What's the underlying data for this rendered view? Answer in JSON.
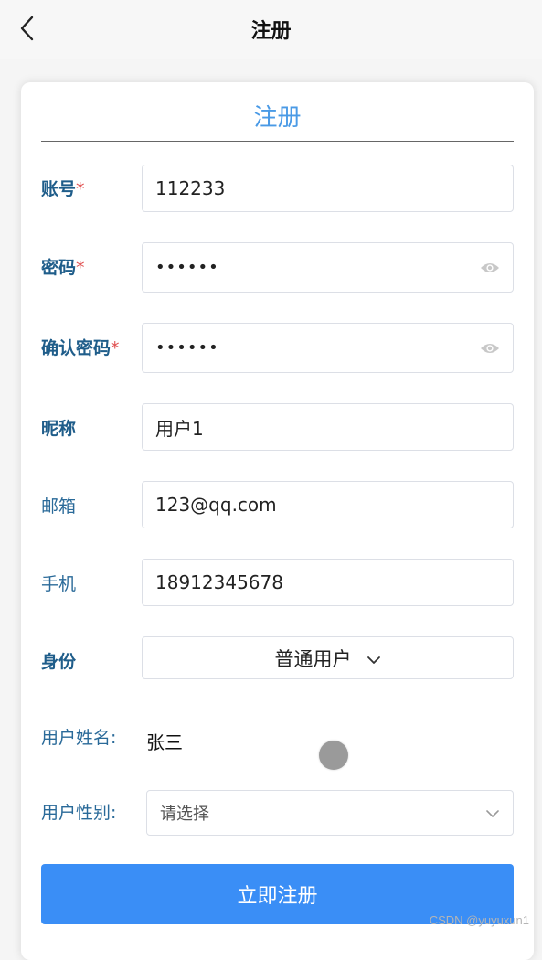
{
  "header": {
    "title": "注册",
    "back_icon": "chevron-left-icon"
  },
  "card": {
    "title": "注册"
  },
  "form": {
    "account": {
      "label": "账号",
      "required": "*",
      "value": "112233"
    },
    "password": {
      "label": "密码",
      "required": "*",
      "value": "••••••",
      "toggle_icon": "eye-icon"
    },
    "confirm_password": {
      "label": "确认密码",
      "required": "*",
      "value": "••••••",
      "toggle_icon": "eye-icon"
    },
    "nickname": {
      "label": "昵称",
      "value": "用户1"
    },
    "email": {
      "label": "邮箱",
      "value": "123@qq.com"
    },
    "phone": {
      "label": "手机",
      "value": "18912345678"
    },
    "identity": {
      "label": "身份",
      "value": "普通用户",
      "icon": "chevron-down-icon"
    },
    "real_name": {
      "label": "用户姓名:",
      "value": "张三"
    },
    "gender": {
      "label": "用户性别:",
      "placeholder": "请选择",
      "icon": "chevron-down-icon"
    }
  },
  "submit_label": "立即注册",
  "watermark": "CSDN @yuyuxun1",
  "colors": {
    "accent": "#3a8ef6",
    "title_blue": "#4a9ae6",
    "label_blue": "#1f5d8a",
    "required_red": "#e05050"
  }
}
